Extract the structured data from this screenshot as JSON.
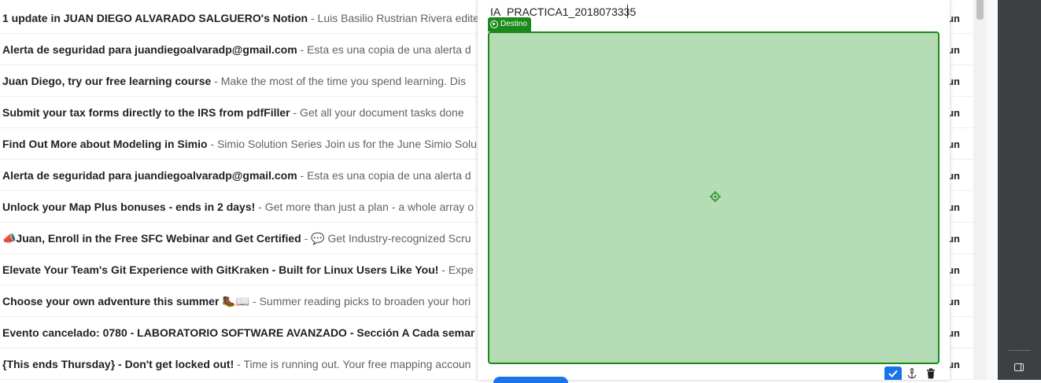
{
  "inbox": {
    "emails": [
      {
        "subject": "1 update in JUAN DIEGO ALVARADO SALGUERO's Notion",
        "snippet": " - Luis Basilio Rustrian Rivera edited",
        "date": "un"
      },
      {
        "subject": "Alerta de seguridad para juandiegoalvaradp@gmail.com",
        "snippet": " - Esta es una copia de una alerta d",
        "date": "un"
      },
      {
        "subject": "Juan Diego, try our free learning course",
        "snippet": " - Make the most of the time you spend learning. Dis",
        "date": "un"
      },
      {
        "subject": "Submit your tax forms directly to the IRS from pdfFiller",
        "snippet": " - Get all your document tasks done",
        "date": "un"
      },
      {
        "subject": "Find Out More about Modeling in Simio",
        "snippet": " - Simio Solution Series Join us for the June Simio Solu",
        "date": "un"
      },
      {
        "subject": "Alerta de seguridad para juandiegoalvaradp@gmail.com",
        "snippet": " - Esta es una copia de una alerta d",
        "date": "un"
      },
      {
        "subject": "Unlock your Map Plus bonuses - ends in 2 days!",
        "snippet": " - Get more than just a plan - a whole array o",
        "date": "un"
      },
      {
        "subject": "📣Juan, Enroll in the Free SFC Webinar and Get Certified",
        "snippet": " - 💬 Get Industry-recognized Scru",
        "date": "un"
      },
      {
        "subject": "Elevate Your Team's Git Experience with GitKraken - Built for Linux Users Like You!",
        "snippet": " - Expe",
        "date": "un"
      },
      {
        "subject": "Choose your own adventure this summer 🥾📖",
        "snippet": " - Summer reading picks to broaden your hori",
        "date": "un"
      },
      {
        "subject": "Evento cancelado: 0780 - LABORATORIO SOFTWARE AVANZADO - Sección A Cada semar",
        "snippet": "",
        "date": "un"
      },
      {
        "subject": "{This ends Thursday} - Don't get locked out!",
        "snippet": " - Time is running out. Your free mapping accoun",
        "date": "un"
      }
    ]
  },
  "compose": {
    "subject_value": "IA_PRACTICA1_2018073335",
    "drop_label": "Destino"
  },
  "colors": {
    "drop_fill": "#b5dcb5",
    "drop_border": "#1a8a1a",
    "accent_blue": "#1a73e8",
    "side_panel": "#3c4043"
  },
  "icons": {
    "drop_tag": "target-icon",
    "drop_center": "crosshair-icon",
    "tools": [
      "check-icon",
      "anchor-icon",
      "trash-icon"
    ],
    "side_panel": "side-panel-toggle-icon"
  }
}
